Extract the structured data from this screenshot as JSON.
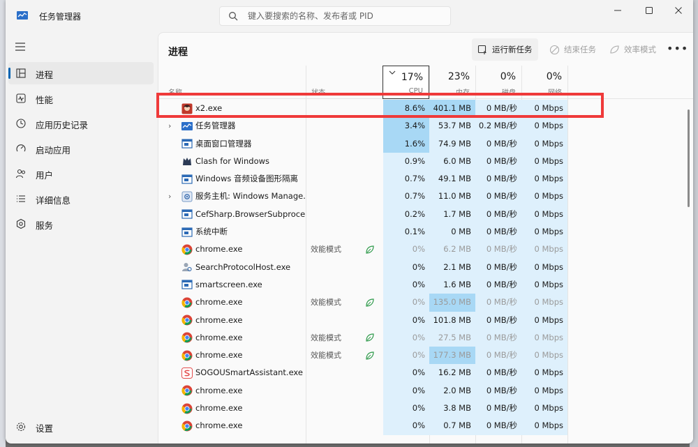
{
  "window": {
    "title": "任务管理器"
  },
  "search": {
    "placeholder": "键入要搜索的名称、发布者或 PID"
  },
  "sidebar": {
    "items": [
      {
        "label": "进程",
        "icon": "processes-icon",
        "active": true
      },
      {
        "label": "性能",
        "icon": "performance-icon"
      },
      {
        "label": "应用历史记录",
        "icon": "app-history-icon"
      },
      {
        "label": "启动应用",
        "icon": "startup-icon"
      },
      {
        "label": "用户",
        "icon": "users-icon"
      },
      {
        "label": "详细信息",
        "icon": "details-icon"
      },
      {
        "label": "服务",
        "icon": "services-icon"
      }
    ],
    "settings_label": "设置"
  },
  "main": {
    "title": "进程",
    "run_task_label": "运行新任务",
    "end_task_label": "结束任务",
    "efficiency_label": "效率模式",
    "more_label": "•••"
  },
  "table": {
    "headers": {
      "name": "名称",
      "status": "状态",
      "cpu_pct": "17%",
      "cpu": "CPU",
      "mem_pct": "23%",
      "mem": "内存",
      "disk_pct": "0%",
      "disk": "磁盘",
      "net_pct": "0%",
      "net": "网络"
    },
    "rows": [
      {
        "name": "x2.exe",
        "expand": "",
        "icon": "game-icon",
        "status": "",
        "cpu": "8.6%",
        "mem": "401.1 MB",
        "disk": "0 MB/秒",
        "net": "0 Mbps"
      },
      {
        "name": "任务管理器",
        "expand": "›",
        "icon": "taskmgr-icon",
        "status": "",
        "cpu": "3.4%",
        "mem": "53.7 MB",
        "disk": "0.2 MB/秒",
        "net": "0 Mbps"
      },
      {
        "name": "桌面窗口管理器",
        "expand": "",
        "icon": "window-icon",
        "status": "",
        "cpu": "1.6%",
        "mem": "74.9 MB",
        "disk": "0 MB/秒",
        "net": "0 Mbps"
      },
      {
        "name": "Clash for Windows",
        "expand": "",
        "icon": "clash-icon",
        "status": "",
        "cpu": "0.9%",
        "mem": "6.0 MB",
        "disk": "0 MB/秒",
        "net": "0 Mbps"
      },
      {
        "name": "Windows 音频设备图形隔离",
        "expand": "",
        "icon": "window-icon",
        "status": "",
        "cpu": "0.7%",
        "mem": "49.1 MB",
        "disk": "0 MB/秒",
        "net": "0 Mbps"
      },
      {
        "name": "服务主机: Windows Manage...",
        "expand": "›",
        "icon": "service-host-icon",
        "status": "",
        "cpu": "0.7%",
        "mem": "11.0 MB",
        "disk": "0 MB/秒",
        "net": "0 Mbps"
      },
      {
        "name": "CefSharp.BrowserSubproce...",
        "expand": "",
        "icon": "window-icon",
        "status": "",
        "cpu": "0.2%",
        "mem": "1.7 MB",
        "disk": "0 MB/秒",
        "net": "0 Mbps"
      },
      {
        "name": "系统中断",
        "expand": "",
        "icon": "window-icon",
        "status": "",
        "cpu": "0.1%",
        "mem": "0 MB",
        "disk": "0 MB/秒",
        "net": "0 Mbps"
      },
      {
        "name": "chrome.exe",
        "expand": "",
        "icon": "chrome-icon",
        "status": "效能模式",
        "eff": true,
        "cpu": "0%",
        "mem": "6.2 MB",
        "disk": "0 MB/秒",
        "net": "0 Mbps"
      },
      {
        "name": "SearchProtocolHost.exe",
        "expand": "",
        "icon": "search-host-icon",
        "status": "",
        "cpu": "0%",
        "mem": "2.1 MB",
        "disk": "0 MB/秒",
        "net": "0 Mbps"
      },
      {
        "name": "smartscreen.exe",
        "expand": "",
        "icon": "window-icon",
        "status": "",
        "cpu": "0%",
        "mem": "1.6 MB",
        "disk": "0 MB/秒",
        "net": "0 Mbps"
      },
      {
        "name": "chrome.exe",
        "expand": "",
        "icon": "chrome-icon",
        "status": "效能模式",
        "eff": true,
        "cpu": "0%",
        "mem": "135.0 MB",
        "disk": "0 MB/秒",
        "net": "0 Mbps"
      },
      {
        "name": "chrome.exe",
        "expand": "",
        "icon": "chrome-icon",
        "status": "",
        "cpu": "0%",
        "mem": "101.8 MB",
        "disk": "0 MB/秒",
        "net": "0 Mbps"
      },
      {
        "name": "chrome.exe",
        "expand": "",
        "icon": "chrome-icon",
        "status": "效能模式",
        "eff": true,
        "cpu": "0%",
        "mem": "27.5 MB",
        "disk": "0 MB/秒",
        "net": "0 Mbps"
      },
      {
        "name": "chrome.exe",
        "expand": "",
        "icon": "chrome-icon",
        "status": "效能模式",
        "eff": true,
        "cpu": "0%",
        "mem": "177.3 MB",
        "disk": "0 MB/秒",
        "net": "0 Mbps"
      },
      {
        "name": "SOGOUSmartAssistant.exe ...",
        "expand": "",
        "icon": "sogou-icon",
        "status": "",
        "cpu": "0%",
        "mem": "16.2 MB",
        "disk": "0 MB/秒",
        "net": "0 Mbps"
      },
      {
        "name": "chrome.exe",
        "expand": "",
        "icon": "chrome-icon",
        "status": "",
        "cpu": "0%",
        "mem": "2.0 MB",
        "disk": "0 MB/秒",
        "net": "0 Mbps"
      },
      {
        "name": "chrome.exe",
        "expand": "",
        "icon": "chrome-icon",
        "status": "",
        "cpu": "0%",
        "mem": "3.8 MB",
        "disk": "0 MB/秒",
        "net": "0 Mbps"
      },
      {
        "name": "chrome.exe",
        "expand": "",
        "icon": "chrome-icon",
        "status": "",
        "cpu": "0%",
        "mem": "0.7 MB",
        "disk": "0 MB/秒",
        "net": "0 Mbps"
      }
    ]
  },
  "colors": {
    "cpu_heat_high": "#a8d8f5",
    "cpu_heat_low": "#def0fc",
    "mem_heat_high": "#a8d8f5",
    "col_bg": "#def0fc",
    "highlight_box": "#ef3a3a",
    "accent": "#0063b1"
  }
}
